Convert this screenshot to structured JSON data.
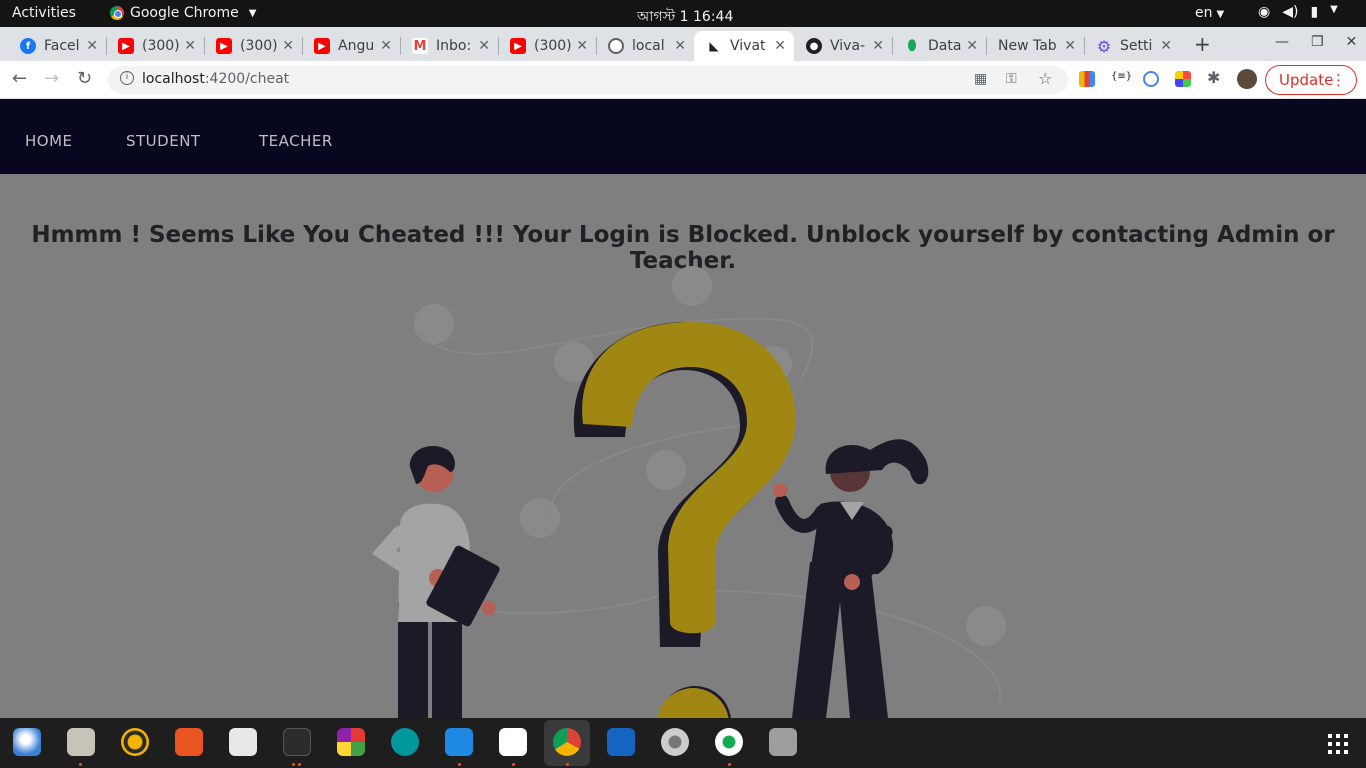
{
  "system": {
    "activities": "Activities",
    "app_name": "Google Chrome",
    "clock": "আগস্ট 1  16:44",
    "language": "en"
  },
  "tabs": [
    {
      "title": "Facel",
      "icon": "facebook-icon",
      "color": "#1877f2"
    },
    {
      "title": "(300)",
      "icon": "youtube-icon",
      "color": "#ff0000"
    },
    {
      "title": "(300)",
      "icon": "youtube-icon",
      "color": "#ff0000"
    },
    {
      "title": "Angu",
      "icon": "youtube-icon",
      "color": "#ff0000"
    },
    {
      "title": "Inbo:",
      "icon": "gmail-icon",
      "color": "#ea4335"
    },
    {
      "title": "(300)",
      "icon": "youtube-icon",
      "color": "#ff0000"
    },
    {
      "title": "local",
      "icon": "globe-icon",
      "color": "#5f6368"
    },
    {
      "title": "Vivat",
      "icon": "app-icon",
      "color": "#202124"
    },
    {
      "title": "Viva-",
      "icon": "github-icon",
      "color": "#202124"
    },
    {
      "title": "Data",
      "icon": "mongodb-icon",
      "color": "#13aa52"
    },
    {
      "title": "New Tab",
      "icon": "",
      "color": ""
    },
    {
      "title": "Setti",
      "icon": "settings-gear-icon",
      "color": "#6b4ede"
    }
  ],
  "toolbar": {
    "url_host": "localhost",
    "url_path": ":4200/cheat",
    "update_label": "Update"
  },
  "nav": {
    "home": "HOME",
    "student": "STUDENT",
    "teacher": "TEACHER"
  },
  "main": {
    "message": "Hmmm ! Seems Like You Cheated !!! Your Login is Blocked. Unblock yourself by contacting Admin or Teacher."
  },
  "colors": {
    "navbar_bg": "#070820",
    "page_overlay": "#7f7f7f",
    "question_mark": "#a08714",
    "figure_dark": "#1d1a28",
    "update_red": "#d93025"
  },
  "dock": [
    "thunderbird-icon",
    "files-icon",
    "rhythmbox-icon",
    "software-center-icon",
    "reader-icon",
    "terminal-icon",
    "app-grid-icon",
    "arduino-icon",
    "vscode-icon",
    "text-editor-icon",
    "chrome-icon",
    "docs-icon",
    "settings-icon",
    "mongodb-compass-icon",
    "disk-icon"
  ]
}
